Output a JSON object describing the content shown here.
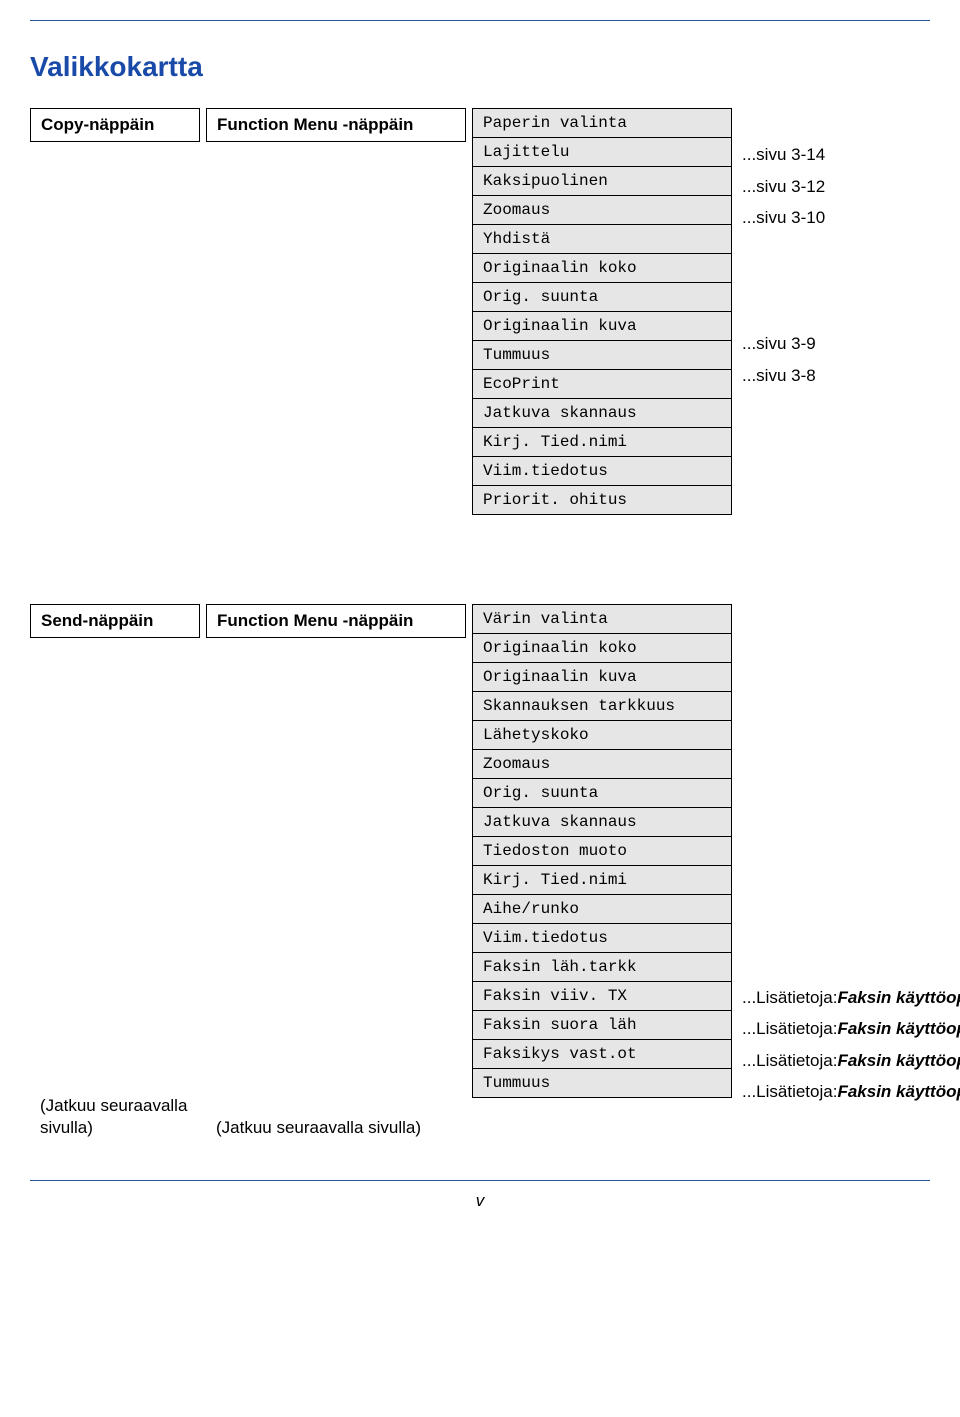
{
  "title": "Valikkokartta",
  "section1": {
    "left": "Copy-näppäin",
    "mid": "Function Menu -näppäin",
    "menu": [
      "Paperin valinta",
      "Lajittelu",
      "Kaksipuolinen",
      "Zoomaus",
      "Yhdistä",
      "Originaalin koko",
      "Orig. suunta",
      "Originaalin kuva",
      "Tummuus",
      "EcoPrint",
      "Jatkuva skannaus",
      "Kirj. Tied.nimi",
      "Viim.tiedotus",
      "Priorit. ohitus"
    ],
    "side": [
      "",
      "...sivu 3-14",
      "...sivu 3-12",
      "...sivu 3-10",
      "",
      "",
      "",
      "...sivu 3-9",
      "...sivu 3-8",
      "",
      "",
      "",
      "",
      ""
    ]
  },
  "section2": {
    "left_top": "Send-näppäin",
    "mid_top": "Function Menu -näppäin",
    "left_bottom": "(Jatkuu seuraavalla sivulla)",
    "mid_bottom": "(Jatkuu seuraavalla sivulla)",
    "menu": [
      "Värin valinta",
      "Originaalin koko",
      "Originaalin kuva",
      "Skannauksen tarkkuus",
      "Lähetyskoko",
      "Zoomaus",
      "Orig. suunta",
      "Jatkuva skannaus",
      "Tiedoston muoto",
      "Kirj. Tied.nimi",
      "Aihe/runko",
      "Viim.tiedotus",
      "Faksin läh.tarkk",
      "Faksin viiv. TX",
      "Faksin suora läh",
      "Faksikys vast.ot",
      "Tummuus"
    ],
    "side_prefix": "...Lisätietoja: ",
    "side_em": "Faksin käyttöopas",
    "side_suffix": ".",
    "side_rows": [
      12,
      13,
      14,
      15
    ]
  },
  "footer": "v"
}
